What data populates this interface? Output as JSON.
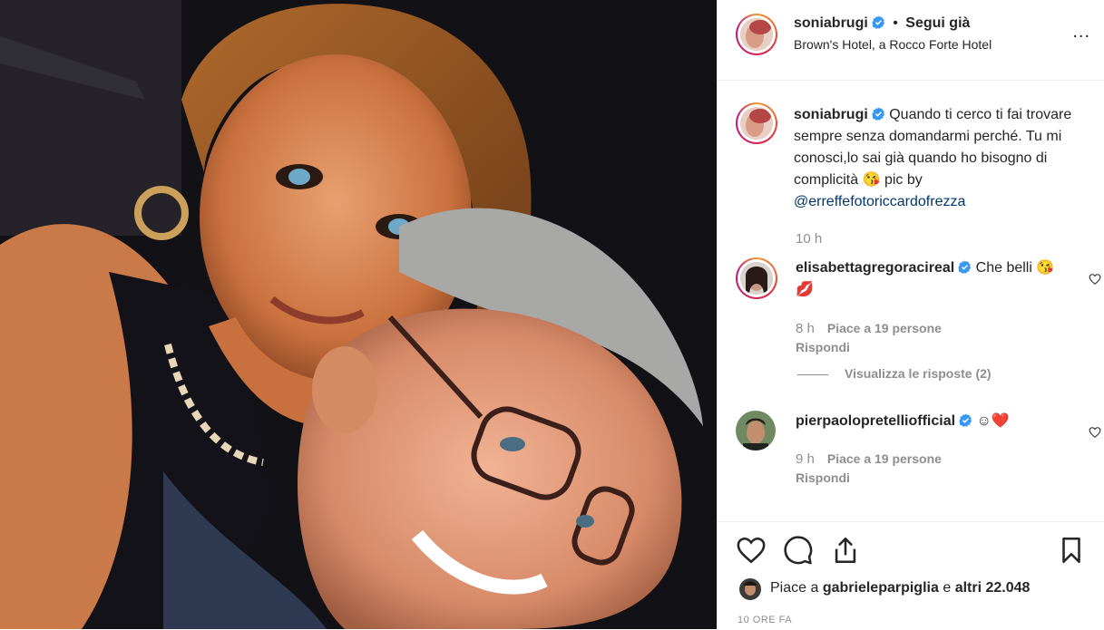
{
  "post": {
    "author": "soniabrugi",
    "separator": "•",
    "follow_status": "Segui già",
    "location": "Brown's Hotel, a Rocco Forte Hotel",
    "more_label": "..."
  },
  "caption": {
    "username": "soniabrugi",
    "text": "Quando ti cerco ti fai trovare sempre senza domandarmi perché. Tu mi conosci,lo sai già quando ho bisogno di complicità 😘 pic by",
    "mention": "@erreffefotoriccardofrezza",
    "time": "10 h"
  },
  "comments": [
    {
      "username": "elisabettagregoracireal",
      "text": "Che belli 😘💋",
      "time": "8 h",
      "likes": "Piace a 19 persone",
      "reply": "Rispondi",
      "view_replies": "Visualizza le risposte (2)"
    },
    {
      "username": "pierpaolopretelliofficial",
      "text": "☺❤️",
      "time": "9 h",
      "likes": "Piace a 19 persone",
      "reply": "Rispondi"
    }
  ],
  "footer": {
    "likes_prefix": "Piace a",
    "likes_user": "gabrieleparpiglia",
    "likes_middle": "e",
    "likes_count": "altri 22.048",
    "time_ago": "10 ORE FA"
  },
  "icons": [
    "heart-icon",
    "comment-icon",
    "share-icon",
    "bookmark-icon",
    "verified-badge-icon",
    "more-icon"
  ],
  "colors": {
    "link": "#00376b",
    "muted": "#8e8e8e",
    "text": "#262626",
    "verified": "#3897f0",
    "heart_red": "#ed4956"
  }
}
